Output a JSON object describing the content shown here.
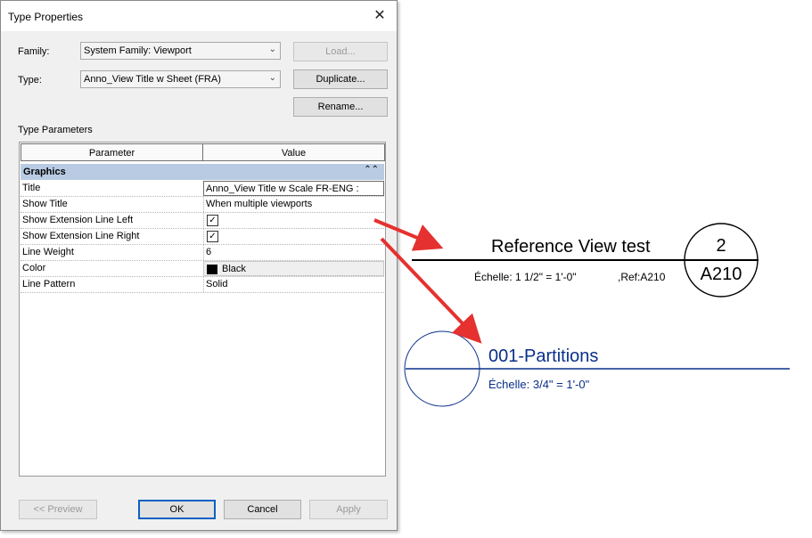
{
  "dialog": {
    "title": "Type Properties",
    "close_glyph": "✕",
    "family_label": "Family:",
    "family_value": "System Family: Viewport",
    "type_label": "Type:",
    "type_value": "Anno_View Title w Sheet (FRA)",
    "load_label": "Load...",
    "duplicate_label": "Duplicate...",
    "rename_label": "Rename...",
    "type_parameters_label": "Type Parameters",
    "grid": {
      "col_parameter": "Parameter",
      "col_value": "Value",
      "group": "Graphics",
      "group_icon": "collapse-icon",
      "rows": [
        {
          "param": "Title",
          "value": "Anno_View Title w Scale FR-ENG :"
        },
        {
          "param": "Show Title",
          "value": "When multiple viewports"
        },
        {
          "param": "Show Extension Line  Left",
          "value": "✓"
        },
        {
          "param": "Show Extension Line Right",
          "value": "✓"
        },
        {
          "param": "Line Weight",
          "value": "6"
        },
        {
          "param": "Color",
          "value": "Black",
          "swatch": "#000000"
        },
        {
          "param": "Line Pattern",
          "value": "Solid"
        }
      ]
    },
    "preview_label": "<< Preview",
    "ok_label": "OK",
    "cancel_label": "Cancel",
    "apply_label": "Apply"
  },
  "drawing": {
    "reference_title": "Reference View test",
    "reference_scale": "Échelle:  1 1/2\" = 1'-0\"",
    "reference_ref": ",Ref:A210",
    "bubble_number": "2",
    "bubble_sheet": "A210",
    "partition_title": "001-Partitions",
    "partition_scale": "Échelle:   3/4\" = 1'-0\"",
    "arrow_color": "#e5312f",
    "partition_color": "#0a2f8a"
  }
}
